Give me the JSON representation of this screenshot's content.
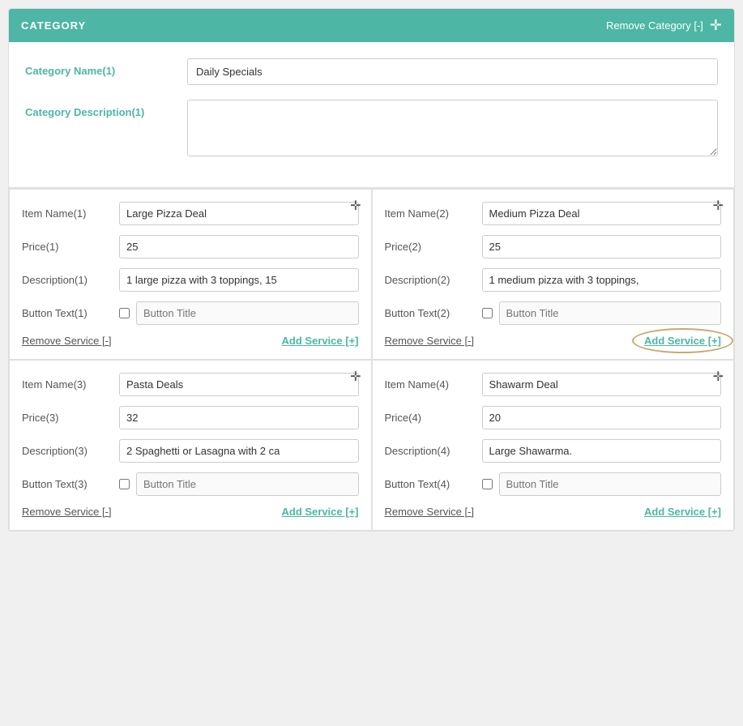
{
  "header": {
    "title": "CATEGORY",
    "remove_label": "Remove Category [-]",
    "plus_icon": "✛"
  },
  "category": {
    "name_label": "Category Name(1)",
    "name_value": "Daily Specials",
    "description_label": "Category Description(1)",
    "description_value": ""
  },
  "services": [
    {
      "item_name_label": "Item Name(1)",
      "item_name_value": "Large Pizza Deal",
      "price_label": "Price(1)",
      "price_value": "25",
      "description_label": "Description(1)",
      "description_value": "1 large pizza with 3 toppings, 15",
      "button_text_label": "Button Text(1)",
      "button_title_placeholder": "Button Title",
      "remove_label": "Remove Service [-]",
      "add_label": "Add Service [+]",
      "highlighted": false
    },
    {
      "item_name_label": "Item Name(2)",
      "item_name_value": "Medium Pizza Deal",
      "price_label": "Price(2)",
      "price_value": "25",
      "description_label": "Description(2)",
      "description_value": "1 medium pizza with 3 toppings,",
      "button_text_label": "Button Text(2)",
      "button_title_placeholder": "Button Title",
      "remove_label": "Remove Service [-]",
      "add_label": "Add Service [+]",
      "highlighted": true
    },
    {
      "item_name_label": "Item Name(3)",
      "item_name_value": "Pasta Deals",
      "price_label": "Price(3)",
      "price_value": "32",
      "description_label": "Description(3)",
      "description_value": "2 Spaghetti or Lasagna with 2 ca",
      "button_text_label": "Button Text(3)",
      "button_title_placeholder": "Button Title",
      "remove_label": "Remove Service [-]",
      "add_label": "Add Service [+]",
      "highlighted": false
    },
    {
      "item_name_label": "Item Name(4)",
      "item_name_value": "Shawarm Deal",
      "price_label": "Price(4)",
      "price_value": "20",
      "description_label": "Description(4)",
      "description_value": "Large Shawarma.",
      "button_text_label": "Button Text(4)",
      "button_title_placeholder": "Button Title",
      "remove_label": "Remove Service [-]",
      "add_label": "Add Service [+]",
      "highlighted": false
    }
  ]
}
